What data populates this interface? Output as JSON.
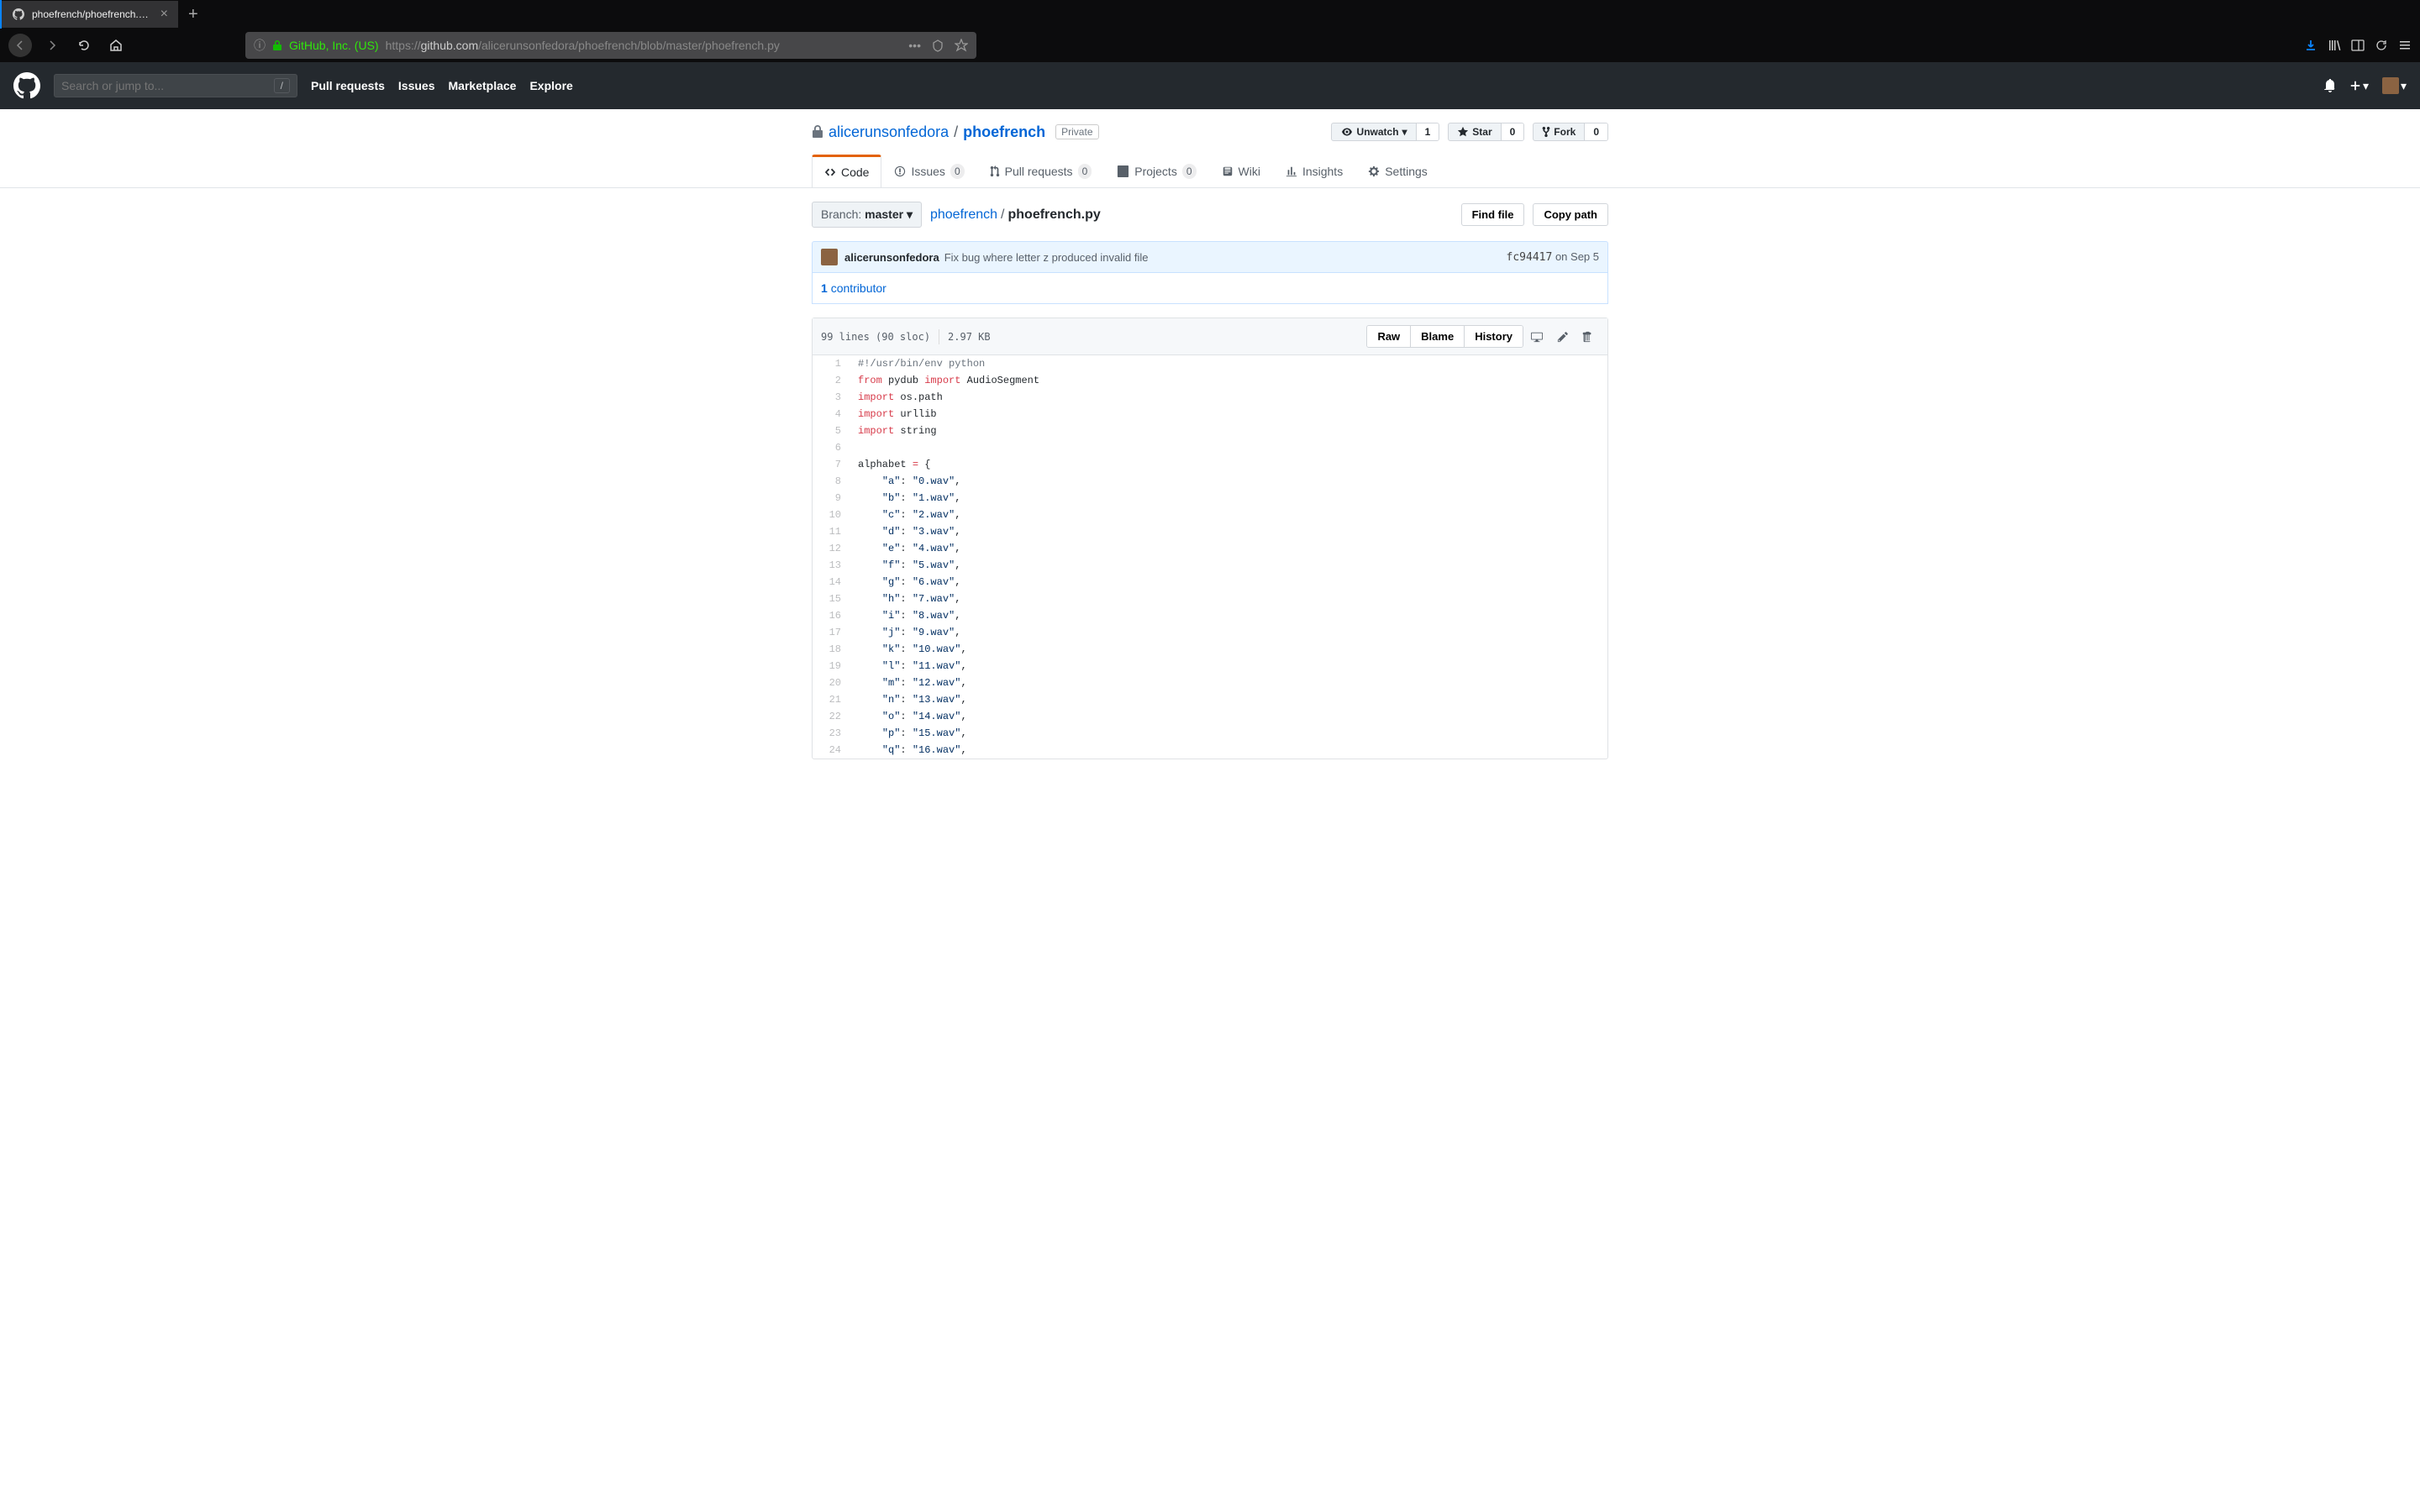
{
  "browser": {
    "tab_title": "phoefrench/phoefrench.py at m",
    "url_company": "GitHub, Inc. (US)",
    "url_prefix": "https://",
    "url_host": "github.com",
    "url_path": "/alicerunsonfedora/phoefrench/blob/master/phoefrench.py"
  },
  "github": {
    "search_placeholder": "Search or jump to...",
    "nav": [
      "Pull requests",
      "Issues",
      "Marketplace",
      "Explore"
    ]
  },
  "repo": {
    "owner": "alicerunsonfedora",
    "name": "phoefrench",
    "privacy": "Private",
    "watch_label": "Unwatch",
    "watch_count": "1",
    "star_label": "Star",
    "star_count": "0",
    "fork_label": "Fork",
    "fork_count": "0"
  },
  "reponav": {
    "code": "Code",
    "issues": "Issues",
    "issues_count": "0",
    "pulls": "Pull requests",
    "pulls_count": "0",
    "projects": "Projects",
    "projects_count": "0",
    "wiki": "Wiki",
    "insights": "Insights",
    "settings": "Settings"
  },
  "filenav": {
    "branch_label": "Branch:",
    "branch_name": "master",
    "root": "phoefrench",
    "file": "phoefrench.py",
    "find_file": "Find file",
    "copy_path": "Copy path"
  },
  "commit": {
    "author": "alicerunsonfedora",
    "message": "Fix bug where letter z produced invalid file",
    "sha": "fc94417",
    "date": "on Sep 5"
  },
  "contributors": {
    "count": "1",
    "label": "contributor"
  },
  "fileinfo": {
    "lines": "99 lines (90 sloc)",
    "size": "2.97 KB",
    "raw": "Raw",
    "blame": "Blame",
    "history": "History"
  },
  "code": [
    {
      "n": "1",
      "t": [
        [
          "c",
          "#!/usr/bin/env python"
        ]
      ]
    },
    {
      "n": "2",
      "t": [
        [
          "k",
          "from"
        ],
        [
          "",
          " pydub "
        ],
        [
          "k",
          "import"
        ],
        [
          "",
          " AudioSegment"
        ]
      ]
    },
    {
      "n": "3",
      "t": [
        [
          "k",
          "import"
        ],
        [
          "",
          " os.path"
        ]
      ]
    },
    {
      "n": "4",
      "t": [
        [
          "k",
          "import"
        ],
        [
          "",
          " urllib"
        ]
      ]
    },
    {
      "n": "5",
      "t": [
        [
          "k",
          "import"
        ],
        [
          "",
          " string"
        ]
      ]
    },
    {
      "n": "6",
      "t": []
    },
    {
      "n": "7",
      "t": [
        [
          "",
          "alphabet "
        ],
        [
          "k",
          "="
        ],
        [
          "",
          " {"
        ]
      ]
    },
    {
      "n": "8",
      "t": [
        [
          "",
          "    "
        ],
        [
          "s",
          "\"a\""
        ],
        [
          "",
          ": "
        ],
        [
          "s",
          "\"0.wav\""
        ],
        [
          "",
          ","
        ]
      ]
    },
    {
      "n": "9",
      "t": [
        [
          "",
          "    "
        ],
        [
          "s",
          "\"b\""
        ],
        [
          "",
          ": "
        ],
        [
          "s",
          "\"1.wav\""
        ],
        [
          "",
          ","
        ]
      ]
    },
    {
      "n": "10",
      "t": [
        [
          "",
          "    "
        ],
        [
          "s",
          "\"c\""
        ],
        [
          "",
          ": "
        ],
        [
          "s",
          "\"2.wav\""
        ],
        [
          "",
          ","
        ]
      ]
    },
    {
      "n": "11",
      "t": [
        [
          "",
          "    "
        ],
        [
          "s",
          "\"d\""
        ],
        [
          "",
          ": "
        ],
        [
          "s",
          "\"3.wav\""
        ],
        [
          "",
          ","
        ]
      ]
    },
    {
      "n": "12",
      "t": [
        [
          "",
          "    "
        ],
        [
          "s",
          "\"e\""
        ],
        [
          "",
          ": "
        ],
        [
          "s",
          "\"4.wav\""
        ],
        [
          "",
          ","
        ]
      ]
    },
    {
      "n": "13",
      "t": [
        [
          "",
          "    "
        ],
        [
          "s",
          "\"f\""
        ],
        [
          "",
          ": "
        ],
        [
          "s",
          "\"5.wav\""
        ],
        [
          "",
          ","
        ]
      ]
    },
    {
      "n": "14",
      "t": [
        [
          "",
          "    "
        ],
        [
          "s",
          "\"g\""
        ],
        [
          "",
          ": "
        ],
        [
          "s",
          "\"6.wav\""
        ],
        [
          "",
          ","
        ]
      ]
    },
    {
      "n": "15",
      "t": [
        [
          "",
          "    "
        ],
        [
          "s",
          "\"h\""
        ],
        [
          "",
          ": "
        ],
        [
          "s",
          "\"7.wav\""
        ],
        [
          "",
          ","
        ]
      ]
    },
    {
      "n": "16",
      "t": [
        [
          "",
          "    "
        ],
        [
          "s",
          "\"i\""
        ],
        [
          "",
          ": "
        ],
        [
          "s",
          "\"8.wav\""
        ],
        [
          "",
          ","
        ]
      ]
    },
    {
      "n": "17",
      "t": [
        [
          "",
          "    "
        ],
        [
          "s",
          "\"j\""
        ],
        [
          "",
          ": "
        ],
        [
          "s",
          "\"9.wav\""
        ],
        [
          "",
          ","
        ]
      ]
    },
    {
      "n": "18",
      "t": [
        [
          "",
          "    "
        ],
        [
          "s",
          "\"k\""
        ],
        [
          "",
          ": "
        ],
        [
          "s",
          "\"10.wav\""
        ],
        [
          "",
          ","
        ]
      ]
    },
    {
      "n": "19",
      "t": [
        [
          "",
          "    "
        ],
        [
          "s",
          "\"l\""
        ],
        [
          "",
          ": "
        ],
        [
          "s",
          "\"11.wav\""
        ],
        [
          "",
          ","
        ]
      ]
    },
    {
      "n": "20",
      "t": [
        [
          "",
          "    "
        ],
        [
          "s",
          "\"m\""
        ],
        [
          "",
          ": "
        ],
        [
          "s",
          "\"12.wav\""
        ],
        [
          "",
          ","
        ]
      ]
    },
    {
      "n": "21",
      "t": [
        [
          "",
          "    "
        ],
        [
          "s",
          "\"n\""
        ],
        [
          "",
          ": "
        ],
        [
          "s",
          "\"13.wav\""
        ],
        [
          "",
          ","
        ]
      ]
    },
    {
      "n": "22",
      "t": [
        [
          "",
          "    "
        ],
        [
          "s",
          "\"o\""
        ],
        [
          "",
          ": "
        ],
        [
          "s",
          "\"14.wav\""
        ],
        [
          "",
          ","
        ]
      ]
    },
    {
      "n": "23",
      "t": [
        [
          "",
          "    "
        ],
        [
          "s",
          "\"p\""
        ],
        [
          "",
          ": "
        ],
        [
          "s",
          "\"15.wav\""
        ],
        [
          "",
          ","
        ]
      ]
    },
    {
      "n": "24",
      "t": [
        [
          "",
          "    "
        ],
        [
          "s",
          "\"q\""
        ],
        [
          "",
          ": "
        ],
        [
          "s",
          "\"16.wav\""
        ],
        [
          "",
          ","
        ]
      ]
    }
  ]
}
